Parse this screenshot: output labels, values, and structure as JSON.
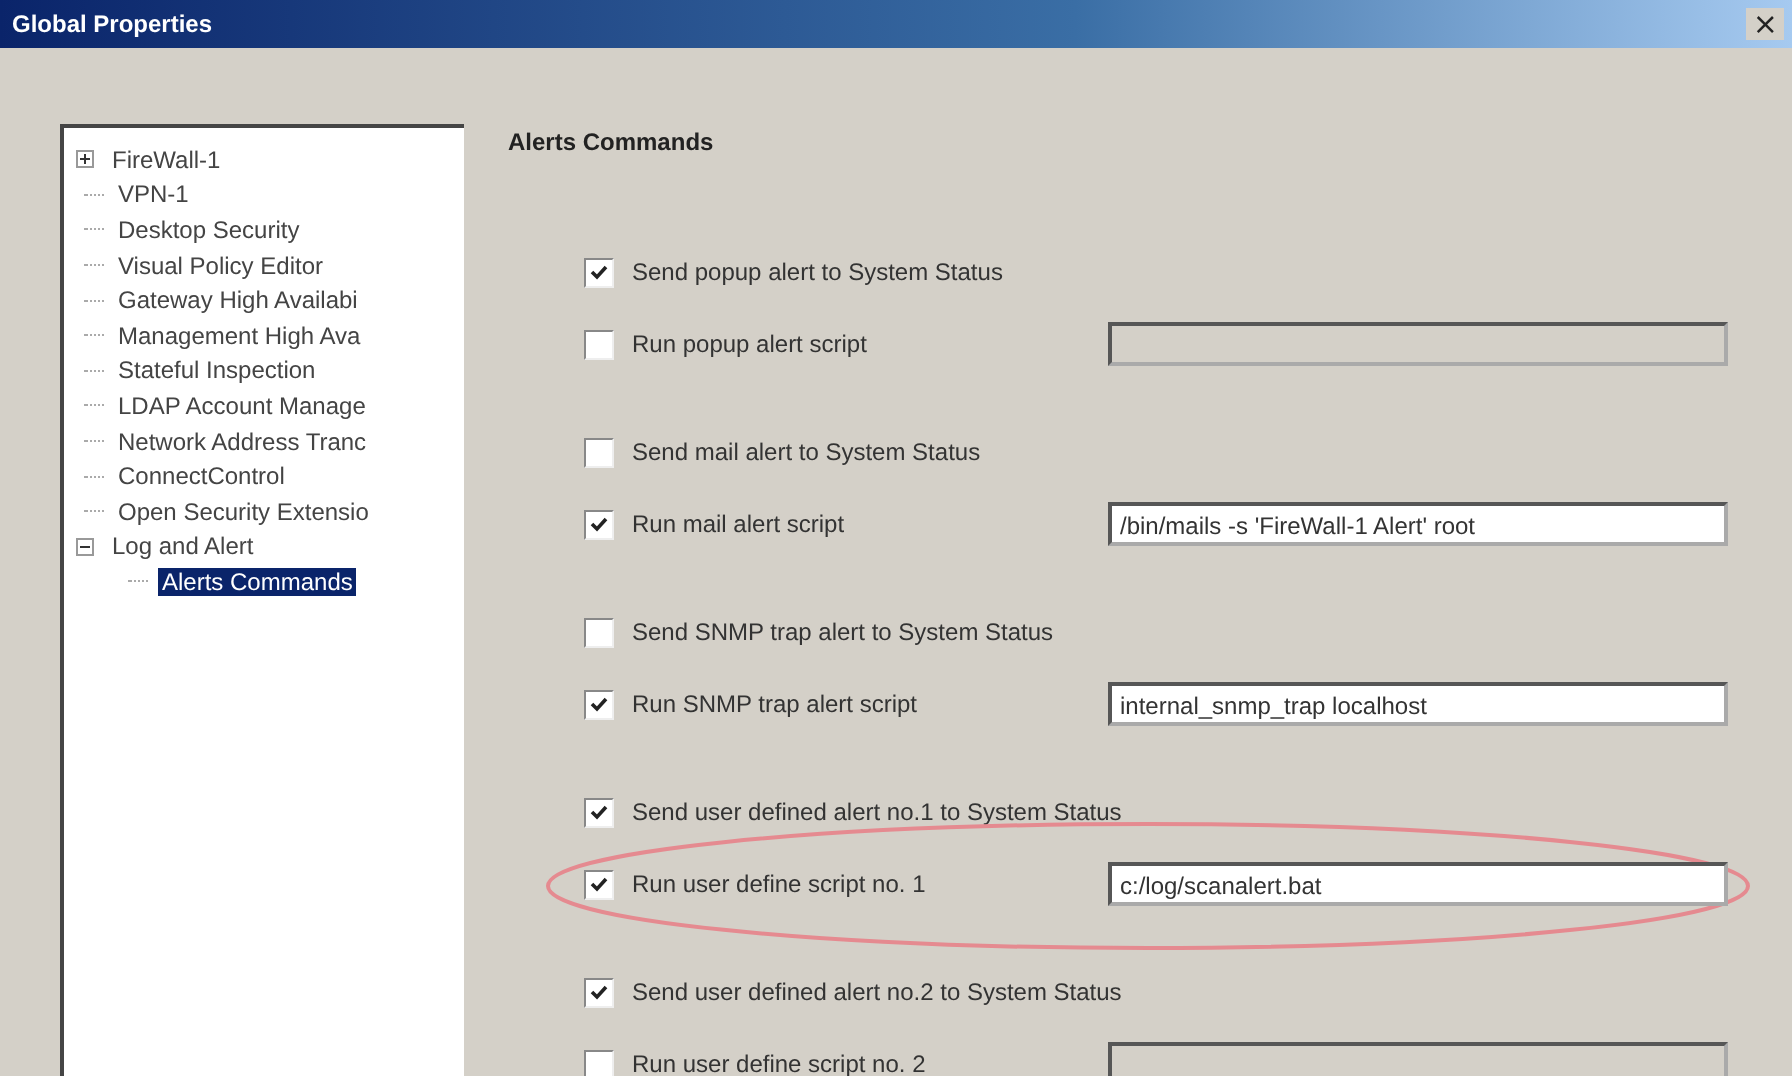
{
  "window": {
    "title": "Global Properties",
    "close_glyph": "×"
  },
  "tree": [
    {
      "label": "FireWall-1",
      "expanded": false,
      "selected": false
    },
    {
      "label": "VPN-1",
      "selected": false
    },
    {
      "label": "Desktop Security",
      "selected": false
    },
    {
      "label": "Visual Policy Editor",
      "selected": false
    },
    {
      "label": "Gateway High Availabi",
      "selected": false
    },
    {
      "label": "Management High Ava",
      "selected": false
    },
    {
      "label": "Stateful Inspection",
      "selected": false
    },
    {
      "label": "LDAP Account Manage",
      "selected": false
    },
    {
      "label": "Network Address Tranc",
      "selected": false
    },
    {
      "label": "ConnectControl",
      "selected": false
    },
    {
      "label": "Open Security Extensio",
      "selected": false
    },
    {
      "label": "Log and Alert",
      "expanded": true,
      "selected": false,
      "children": [
        {
          "label": "Alerts Commands",
          "selected": true
        }
      ]
    }
  ],
  "section": {
    "title": "Alerts Commands"
  },
  "groups": [
    [
      {
        "label": "Send popup alert to System Status",
        "checked": true
      },
      {
        "label": "Run popup alert script",
        "checked": false,
        "field": {
          "disabled": true
        }
      }
    ],
    [
      {
        "label": "Send mail alert to System Status",
        "checked": false
      },
      {
        "label": "Run mail alert script",
        "checked": true,
        "field": {
          "value": "/bin/mails -s 'FireWall-1 Alert' root",
          "disabled": false
        }
      }
    ],
    [
      {
        "label": "Send SNMP trap alert to System Status",
        "checked": false
      },
      {
        "label": "Run SNMP trap alert script",
        "checked": true,
        "field": {
          "value": "internal_snmp_trap localhost",
          "disabled": false
        }
      }
    ],
    [
      {
        "label": "Send user defined alert no.1 to System Status",
        "checked": true
      },
      {
        "label": "Run user define script no. 1",
        "checked": true,
        "highlighted": true,
        "field": {
          "value": "c:/log/scanalert.bat",
          "disabled": false
        }
      }
    ],
    [
      {
        "label": "Send user defined alert no.2 to System Status",
        "checked": true
      },
      {
        "label": "Run user define script no. 2",
        "checked": false,
        "field": {
          "disabled": true
        }
      }
    ]
  ]
}
